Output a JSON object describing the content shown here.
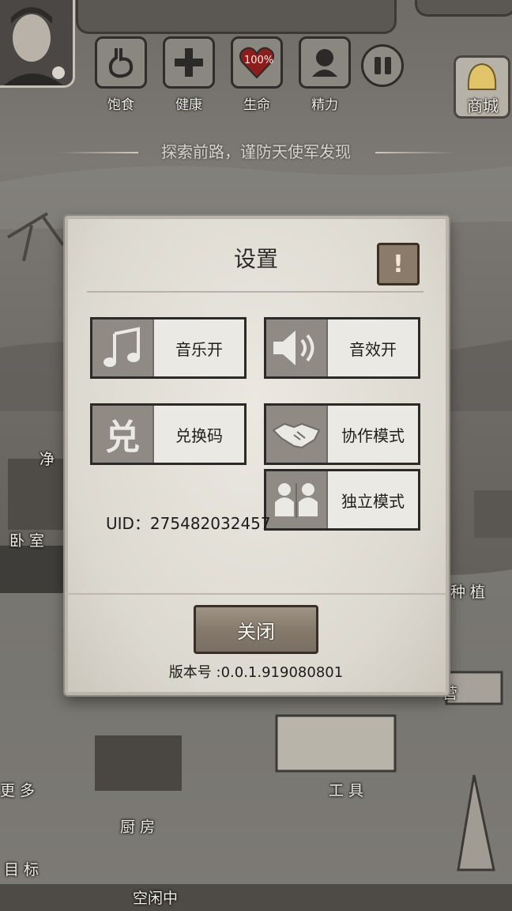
{
  "hud": {
    "stats": [
      {
        "label": "饱食",
        "icon": "stomach-icon"
      },
      {
        "label": "健康",
        "icon": "cross-icon"
      },
      {
        "label": "生命",
        "icon": "heart-icon",
        "value": "100%"
      },
      {
        "label": "精力",
        "icon": "person-icon"
      }
    ],
    "shop_label": "商城",
    "banner": "探索前路，谨防天使军发现"
  },
  "map_labels": {
    "purify": "净",
    "bedroom": "卧 室",
    "planting": "种 植",
    "camp": "营",
    "more": "更 多",
    "tools": "工 具",
    "kitchen": "厨 房",
    "goals": "目 标",
    "idle": "空闲中"
  },
  "settings": {
    "title": "设置",
    "info_icon": "!",
    "options": {
      "music": "音乐开",
      "sound": "音效开",
      "redeem": "兑换码",
      "coop": "协作模式",
      "solo": "独立模式"
    },
    "redeem_glyph": "兑",
    "uid": "UID：275482032457",
    "close_label": "关闭",
    "version": "版本号 :0.0.1.919080801"
  },
  "colors": {
    "panel": "#e3e0d8",
    "icon_bg": "#8f8a83",
    "close_btn": "#867a6d"
  }
}
